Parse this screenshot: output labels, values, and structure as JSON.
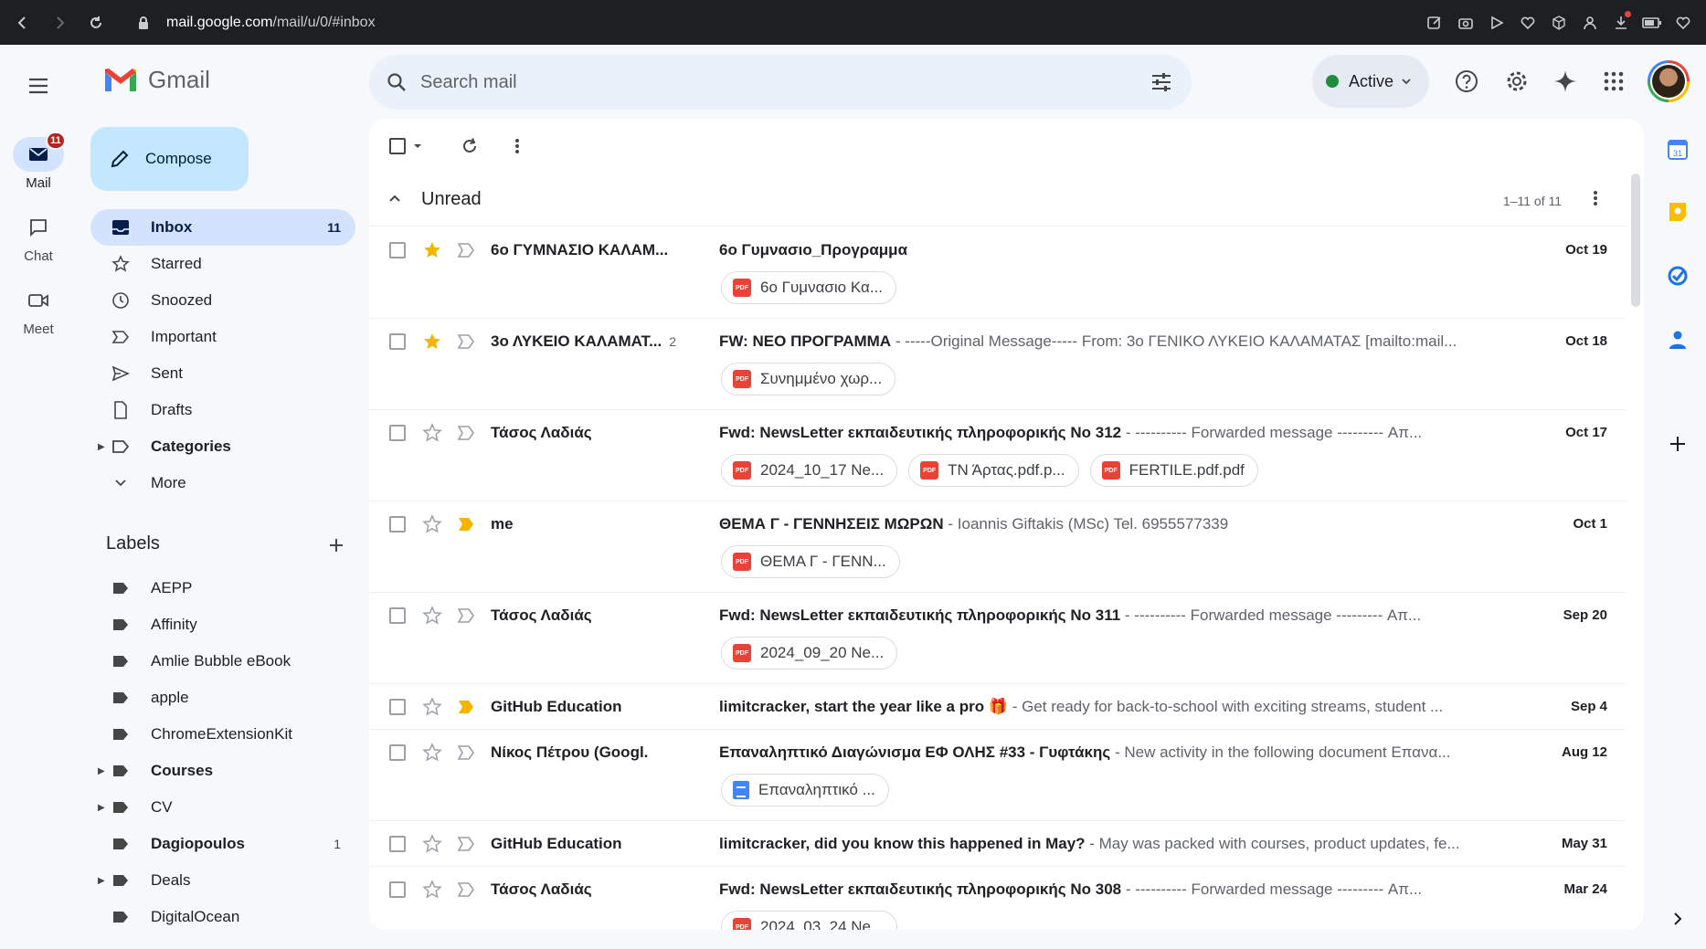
{
  "browser": {
    "url_host": "mail.google.com",
    "url_path": "/mail/u/0/#inbox"
  },
  "rail": {
    "items": [
      {
        "label": "Mail",
        "badge": "11"
      },
      {
        "label": "Chat"
      },
      {
        "label": "Meet"
      }
    ]
  },
  "app": {
    "logo_text": "Gmail"
  },
  "compose": {
    "label": "Compose"
  },
  "nav": {
    "items": [
      {
        "label": "Inbox",
        "count": "11"
      },
      {
        "label": "Starred"
      },
      {
        "label": "Snoozed"
      },
      {
        "label": "Important"
      },
      {
        "label": "Sent"
      },
      {
        "label": "Drafts"
      },
      {
        "label": "Categories"
      },
      {
        "label": "More"
      }
    ]
  },
  "labels": {
    "heading": "Labels",
    "items": [
      {
        "label": "AEPP"
      },
      {
        "label": "Affinity"
      },
      {
        "label": "Amlie Bubble eBook"
      },
      {
        "label": "apple"
      },
      {
        "label": "ChromeExtensionKit"
      },
      {
        "label": "Courses"
      },
      {
        "label": "CV"
      },
      {
        "label": "Dagiopoulos",
        "count": "1"
      },
      {
        "label": "Deals"
      },
      {
        "label": "DigitalOcean"
      }
    ]
  },
  "search": {
    "placeholder": "Search mail"
  },
  "status": {
    "label": "Active"
  },
  "section": {
    "title": "Unread",
    "count": "1–11 of 11"
  },
  "emails": [
    {
      "sender": "6ο ΓΥΜΝΑΣΙΟ ΚΑΛΑΜ...",
      "subject": "6ο Γυμνασιο_Προγραμμα",
      "snippet": "",
      "date": "Oct 19",
      "attachments": [
        "6ο Γυμνασιο Κα..."
      ]
    },
    {
      "sender": "3ο ΛΥΚΕΙΟ ΚΑΛΑΜΑΤ...",
      "thread_count": "2",
      "subject": "FW: ΝΕΟ ΠΡΟΓΡΑΜΜΑ",
      "snippet": " - -----Original Message----- From: 3ο ΓΕΝΙΚΟ ΛΥΚΕΙΟ ΚΑΛΑΜΑΤΑΣ [mailto:mail...",
      "date": "Oct 18",
      "attachments": [
        "Συνημμένο χωρ..."
      ]
    },
    {
      "sender": "Τάσος Λαδιάς",
      "subject": "Fwd: NewsLetter εκπαιδευτικής πληροφορικής No 312",
      "snippet": " - ---------- Forwarded message --------- Απ...",
      "date": "Oct 17",
      "attachments": [
        "2024_10_17 Ne...",
        "ΤΝ Άρτας.pdf.p...",
        "FERTILE.pdf.pdf"
      ]
    },
    {
      "sender": "me",
      "subject": "ΘΕΜΑ Γ - ΓΕΝΝΗΣΕΙΣ ΜΩΡΩΝ",
      "snippet": " - Ioannis Giftakis (MSc) Tel. 6955577339",
      "date": "Oct 1",
      "attachments": [
        "ΘΕΜΑ Γ - ΓΕΝΝ..."
      ]
    },
    {
      "sender": "Τάσος Λαδιάς",
      "subject": "Fwd: NewsLetter εκπαιδευτικής πληροφορικής No 311",
      "snippet": " - ---------- Forwarded message --------- Απ...",
      "date": "Sep 20",
      "attachments": [
        "2024_09_20 Ne..."
      ]
    },
    {
      "sender": "GitHub Education",
      "subject": "limitcracker, start the year like a pro 🎁",
      "snippet": " - Get ready for back-to-school with exciting streams, student ...",
      "date": "Sep 4",
      "attachments": []
    },
    {
      "sender": "Νίκος Πέτρου (Googl.",
      "subject": "Επαναληπτικό Διαγώνισμα ΕΦ ΟΛΗΣ #33 - Γυφτάκης",
      "snippet": " - New activity in the following document Επανα...",
      "date": "Aug 12",
      "attachments": [
        "Επαναληπτικό ..."
      ]
    },
    {
      "sender": "GitHub Education",
      "subject": "limitcracker, did you know this happened in May?",
      "snippet": " - May was packed with courses, product updates, fe...",
      "date": "May 31",
      "attachments": []
    },
    {
      "sender": "Τάσος Λαδιάς",
      "subject": "Fwd: NewsLetter εκπαιδευτικής πληροφορικής No 308",
      "snippet": " - ---------- Forwarded message --------- Απ...",
      "date": "Mar 24",
      "attachments": [
        "2024_03_24 Ne..."
      ]
    }
  ],
  "colors": {
    "accent": "#0b57d0",
    "compose_bg": "#c2e7ff",
    "active_nav": "#d3e3fd",
    "star": "#f4b400",
    "important": "#f4b400",
    "pdf": "#ea4335",
    "status_green": "#1e8e3e"
  }
}
